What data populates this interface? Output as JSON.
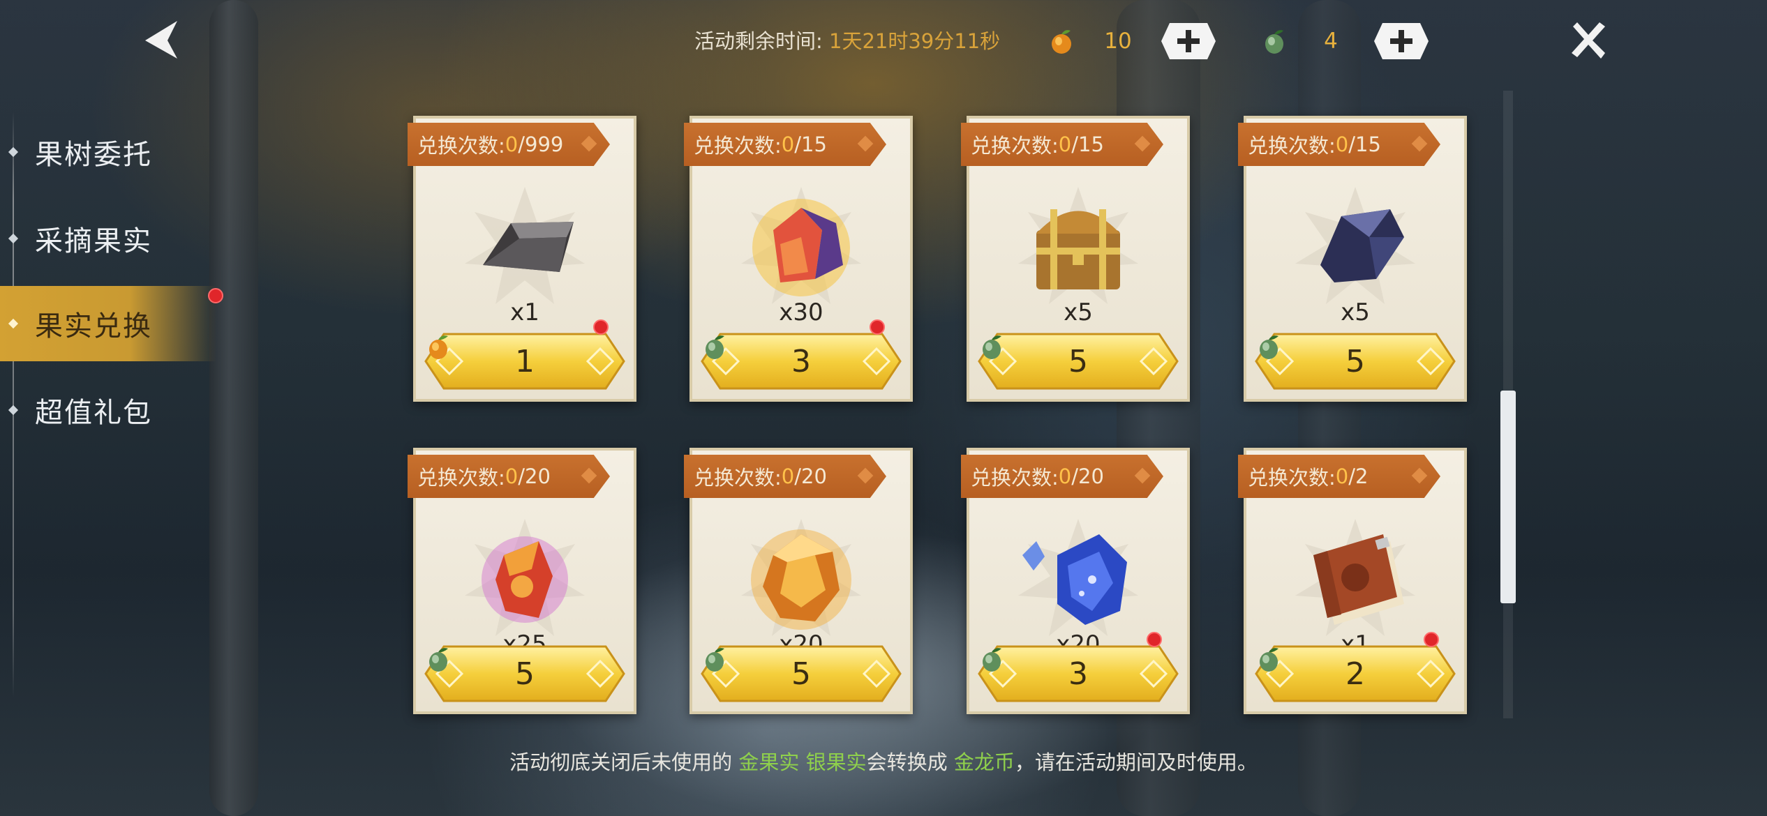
{
  "header": {
    "timer_label": "活动剩余时间:",
    "timer_value": "1天21时39分11秒",
    "gold_fruit_count": "10",
    "silver_fruit_count": "4"
  },
  "sidebar": {
    "items": [
      {
        "label": "果树委托"
      },
      {
        "label": "采摘果实"
      },
      {
        "label": "果实兑换"
      },
      {
        "label": "超值礼包"
      }
    ],
    "active_index": 2
  },
  "cards": [
    {
      "limit_prefix": "兑换次数: ",
      "limit_current": "0",
      "limit_max": "/999",
      "item": "iron-ingot",
      "qty": "x1",
      "currency": "gold-fruit",
      "price": "1",
      "red_dot": true
    },
    {
      "limit_prefix": "兑换次数: ",
      "limit_current": "0",
      "limit_max": "/15",
      "item": "fire-crystal-cluster",
      "qty": "x30",
      "currency": "silver-fruit",
      "price": "3",
      "red_dot": true
    },
    {
      "limit_prefix": "兑换次数: ",
      "limit_current": "0",
      "limit_max": "/15",
      "item": "treasure-chest",
      "qty": "x5",
      "currency": "silver-fruit",
      "price": "5",
      "red_dot": false
    },
    {
      "limit_prefix": "兑换次数: ",
      "limit_current": "0",
      "limit_max": "/15",
      "item": "dark-crystal",
      "qty": "x5",
      "currency": "silver-fruit",
      "price": "5",
      "red_dot": false
    },
    {
      "limit_prefix": "兑换次数: ",
      "limit_current": "0",
      "limit_max": "/20",
      "item": "red-gem",
      "qty": "x25",
      "currency": "silver-fruit",
      "price": "5",
      "red_dot": false
    },
    {
      "limit_prefix": "兑换次数: ",
      "limit_current": "0",
      "limit_max": "/20",
      "item": "amber-gem",
      "qty": "x20",
      "currency": "silver-fruit",
      "price": "5",
      "red_dot": false
    },
    {
      "limit_prefix": "兑换次数: ",
      "limit_current": "0",
      "limit_max": "/20",
      "item": "blue-gem",
      "qty": "x20",
      "currency": "silver-fruit",
      "price": "3",
      "red_dot": true
    },
    {
      "limit_prefix": "兑换次数: ",
      "limit_current": "0",
      "limit_max": "/2",
      "item": "leather-book",
      "qty": "x1",
      "currency": "silver-fruit",
      "price": "2",
      "red_dot": true
    }
  ],
  "footer": {
    "part1": "活动彻底关闭后未使用的 ",
    "gold_fruit": "金果实",
    "sep": " ",
    "silver_fruit": "银果实",
    "part2": "会转换成 ",
    "dragon_coin": "金龙币",
    "part3": "，请在活动期间及时使用。"
  },
  "colors": {
    "accent_gold": "#d9a33a",
    "ribbon": "#c8712e",
    "highlight_green": "#8fd04c",
    "notify_red": "#e0262a"
  }
}
